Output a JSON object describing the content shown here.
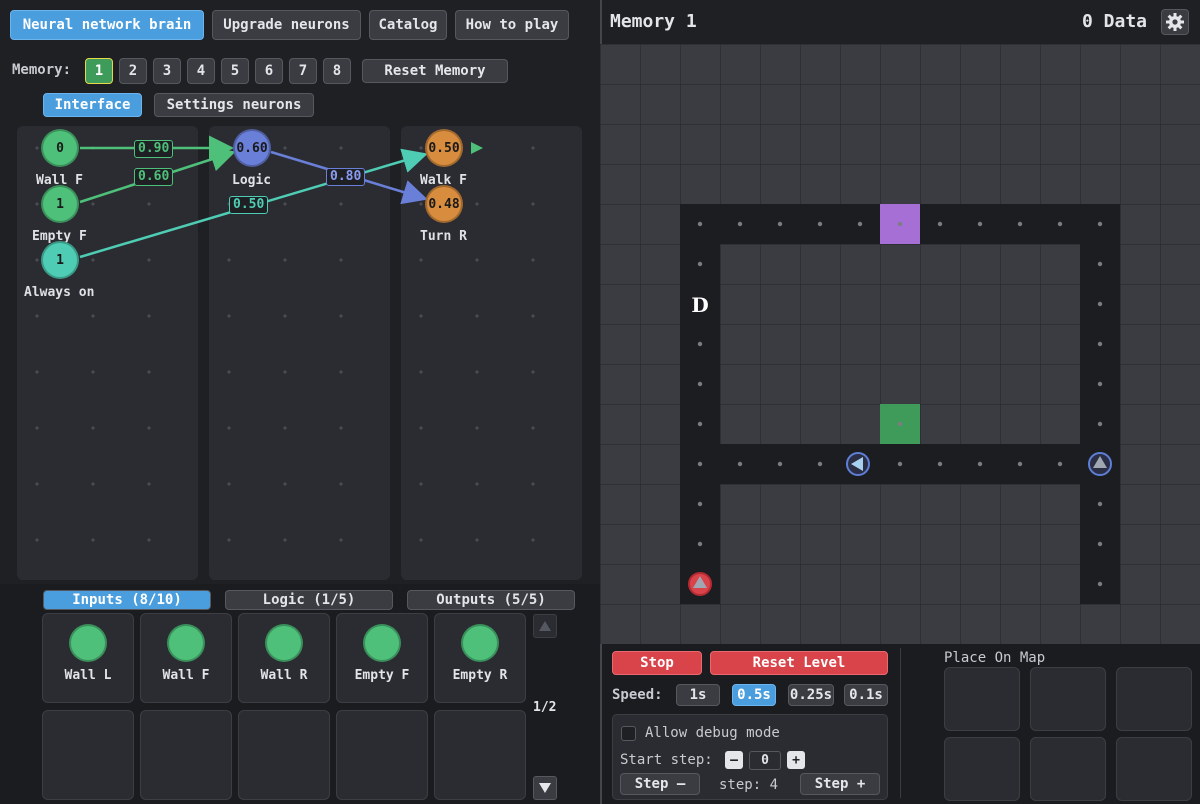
{
  "nav": {
    "tabs": [
      "Neural network brain",
      "Upgrade neurons",
      "Catalog",
      "How to play"
    ]
  },
  "memory": {
    "label": "Memory:",
    "slots": [
      "1",
      "2",
      "3",
      "4",
      "5",
      "6",
      "7",
      "8"
    ],
    "reset": "Reset Memory"
  },
  "subtabs": [
    "Interface",
    "Settings neurons"
  ],
  "nodes": {
    "wall_f": {
      "value": "0",
      "label": "Wall F"
    },
    "empty_f": {
      "value": "1",
      "label": "Empty F"
    },
    "always_on": {
      "value": "1",
      "label": "Always on"
    },
    "logic": {
      "value": "0.60",
      "label": "Logic"
    },
    "walk_f": {
      "value": "0.50",
      "label": "Walk F"
    },
    "turn_r": {
      "value": "0.48",
      "label": "Turn R"
    }
  },
  "weights": {
    "w1": "0.90",
    "w2": "0.60",
    "w3": "0.50",
    "w4": "0.80"
  },
  "bottom_tabs": [
    "Inputs (8/10)",
    "Logic (1/5)",
    "Outputs (5/5)"
  ],
  "input_cards": [
    "Wall L",
    "Wall F",
    "Wall R",
    "Empty F",
    "Empty R"
  ],
  "pager": "1/2",
  "game": {
    "title": "Memory 1",
    "data": "0 Data",
    "start_marker": "D"
  },
  "controls": {
    "stop": "Stop",
    "reset_level": "Reset Level",
    "speed_label": "Speed:",
    "speeds": [
      "1s",
      "0.5s",
      "0.25s",
      "0.1s"
    ],
    "debug": "Allow debug mode",
    "start_step_label": "Start step:",
    "minus": "–",
    "start_step": "0",
    "plus": "+",
    "step_minus": "Step –",
    "step_text": "step: 4",
    "step_plus": "Step +"
  },
  "place": {
    "title": "Place On Map"
  },
  "colors": {
    "accent": "#4a9ede",
    "green": "#4ec07a",
    "orange": "#d88c3e",
    "blue": "#6a7fd8",
    "teal": "#4ecdb4",
    "red": "#d9434a",
    "purple": "#a56fd6"
  }
}
